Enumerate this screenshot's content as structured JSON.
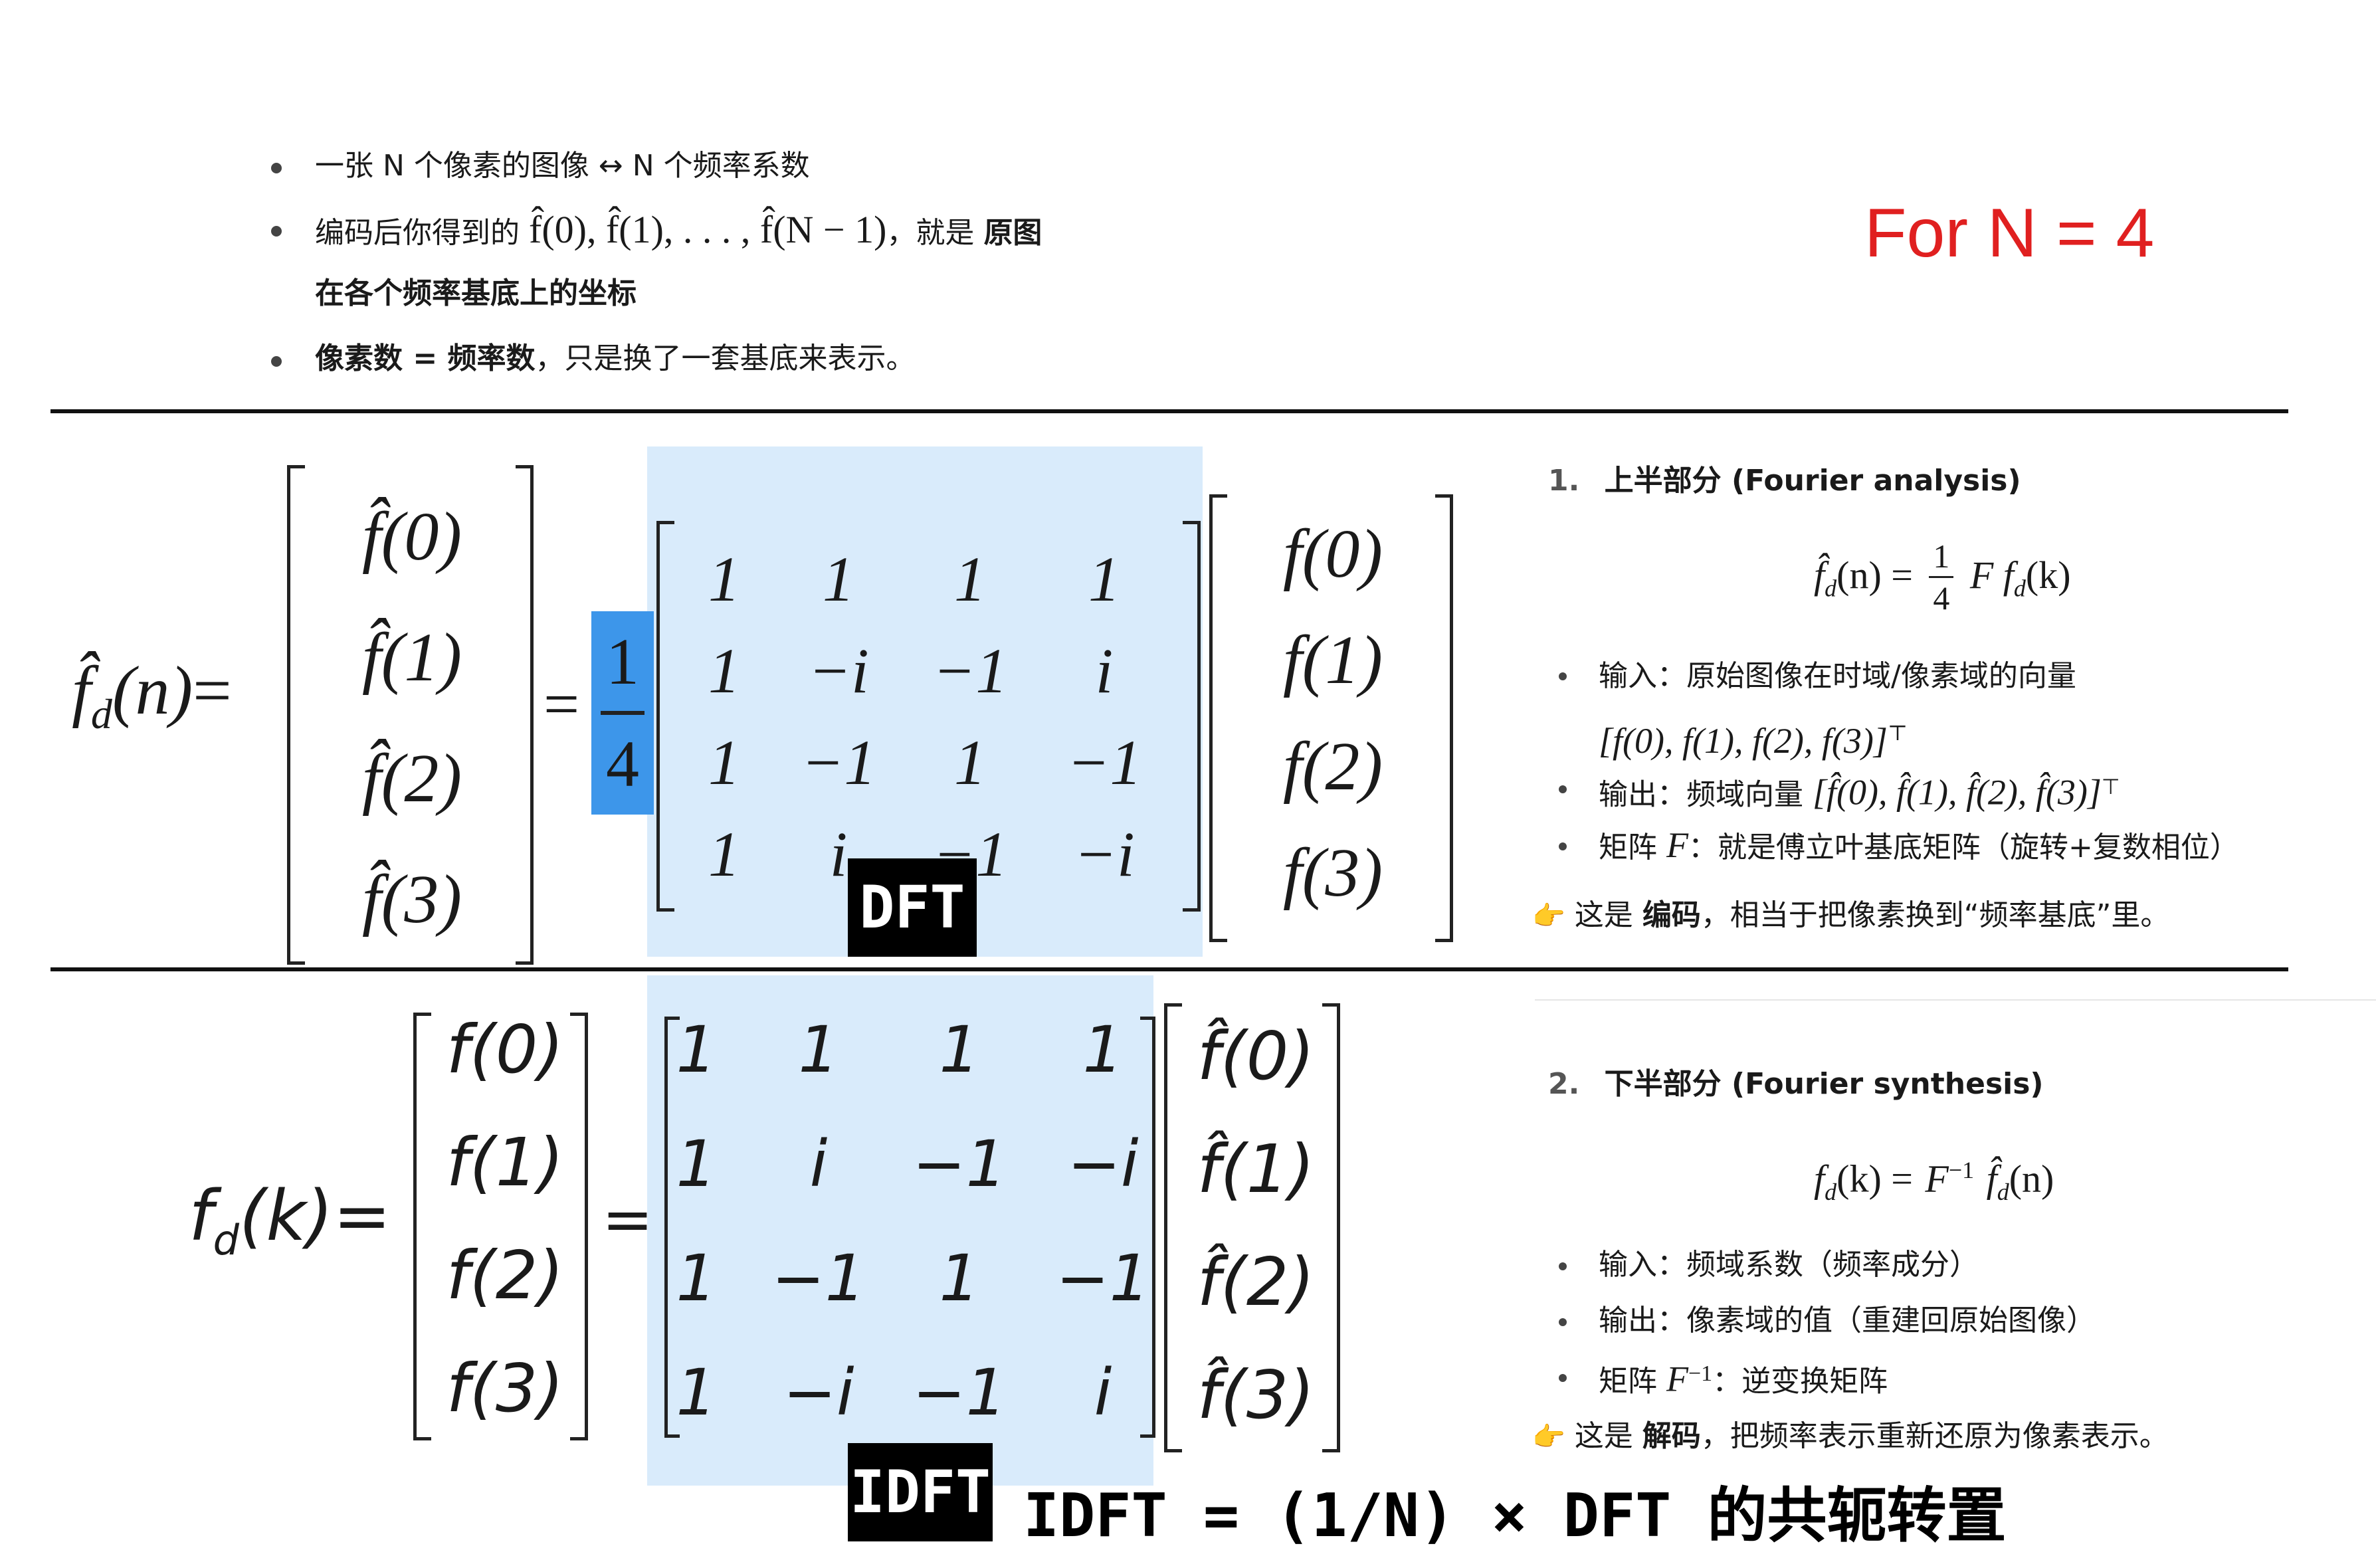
{
  "top_bullets": {
    "b1": "一张 N 个像素的图像 ↔ N 个频率系数",
    "b2_prefix": "编码后你得到的",
    "b2_math": "f̂(0), f̂(1), . . . , f̂(N − 1)",
    "b2_mid": "，就是",
    "b2_bold": "原图",
    "b2_line2": "在各个频率基底上的坐标",
    "b3_bold": "像素数 = 频率数",
    "b3_rest": "，只是换了一套基底来表示。"
  },
  "for_n": {
    "text": "For N = 4",
    "color": "#e02020"
  },
  "dft_equation": {
    "lhs": "f̂",
    "lhs_sub": "d",
    "lhs_arg": "(n)",
    "equals": "=",
    "vector_lhs": [
      "f̂(0)",
      "f̂(1)",
      "f̂(2)",
      "f̂(3)"
    ],
    "frac_num": "1",
    "frac_den": "4",
    "matrix": [
      [
        "1",
        "1",
        "1",
        "1"
      ],
      [
        "1",
        "−i",
        "−1",
        "i"
      ],
      [
        "1",
        "−1",
        "1",
        "−1"
      ],
      [
        "1",
        "i",
        "−1",
        "−i"
      ]
    ],
    "vector_rhs": [
      "f(0)",
      "f(1)",
      "f(2)",
      "f(3)"
    ],
    "label": "DFT",
    "frac_highlight": "#3d96ea"
  },
  "idft_equation": {
    "lhs": "f",
    "lhs_sub": "d",
    "lhs_arg": "(k)",
    "equals": "=",
    "vector_lhs": [
      "f(0)",
      "f(1)",
      "f(2)",
      "f(3)"
    ],
    "matrix": [
      [
        "1",
        "1",
        "1",
        "1"
      ],
      [
        "1",
        "i",
        "−1",
        "−i"
      ],
      [
        "1",
        "−1",
        "1",
        "−1"
      ],
      [
        "1",
        "−i",
        "−1",
        "i"
      ]
    ],
    "vector_rhs": [
      "f̂(0)",
      "f̂(1)",
      "f̂(2)",
      "f̂(3)"
    ],
    "label": "IDFT"
  },
  "caption": "IDFT = (1/N) × DFT 的共轭转置",
  "highlight_color": "#d9ebfb",
  "right_panel_1": {
    "heading_num": "1.",
    "heading": "上半部分 (Fourier analysis)",
    "formula_lhs": "f̂",
    "formula_lhs_sub": "d",
    "formula_lhs_arg": "(n) =",
    "formula_frac_num": "1",
    "formula_frac_den": "4",
    "formula_rhs": "F f",
    "formula_rhs_sub": "d",
    "formula_rhs_arg": "(k)",
    "input_label": "输入：原始图像在时域/像素域的向量",
    "input_math": "[f(0), f(1), f(2), f(3)]",
    "input_sup": "⊤",
    "output_label": "输出：频域向量",
    "output_math": "[f̂(0), f̂(1), f̂(2), f̂(3)]",
    "output_sup": "⊤",
    "matrix_label": "矩阵",
    "matrix_sym": "F",
    "matrix_desc": "：就是傅立叶基底矩阵（旋转+复数相位）",
    "note_icon": "👉",
    "note_prefix": "这是",
    "note_bold": "编码",
    "note_rest": "，相当于把像素换到“频率基底”里。"
  },
  "right_panel_2": {
    "heading_num": "2.",
    "heading": "下半部分 (Fourier synthesis)",
    "formula_lhs": "f",
    "formula_lhs_sub": "d",
    "formula_lhs_arg": "(k) =",
    "formula_F": "F",
    "formula_sup": "−1",
    "formula_rhs": "f̂",
    "formula_rhs_sub": "d",
    "formula_rhs_arg": "(n)",
    "input_label": "输入：频域系数（频率成分）",
    "output_label": "输出：像素域的值（重建回原始图像）",
    "matrix_label": "矩阵",
    "matrix_sym": "F",
    "matrix_sup": "−1",
    "matrix_desc": "：逆变换矩阵",
    "note_icon": "👉",
    "note_prefix": "这是",
    "note_bold": "解码",
    "note_rest": "，把频率表示重新还原为像素表示。"
  }
}
